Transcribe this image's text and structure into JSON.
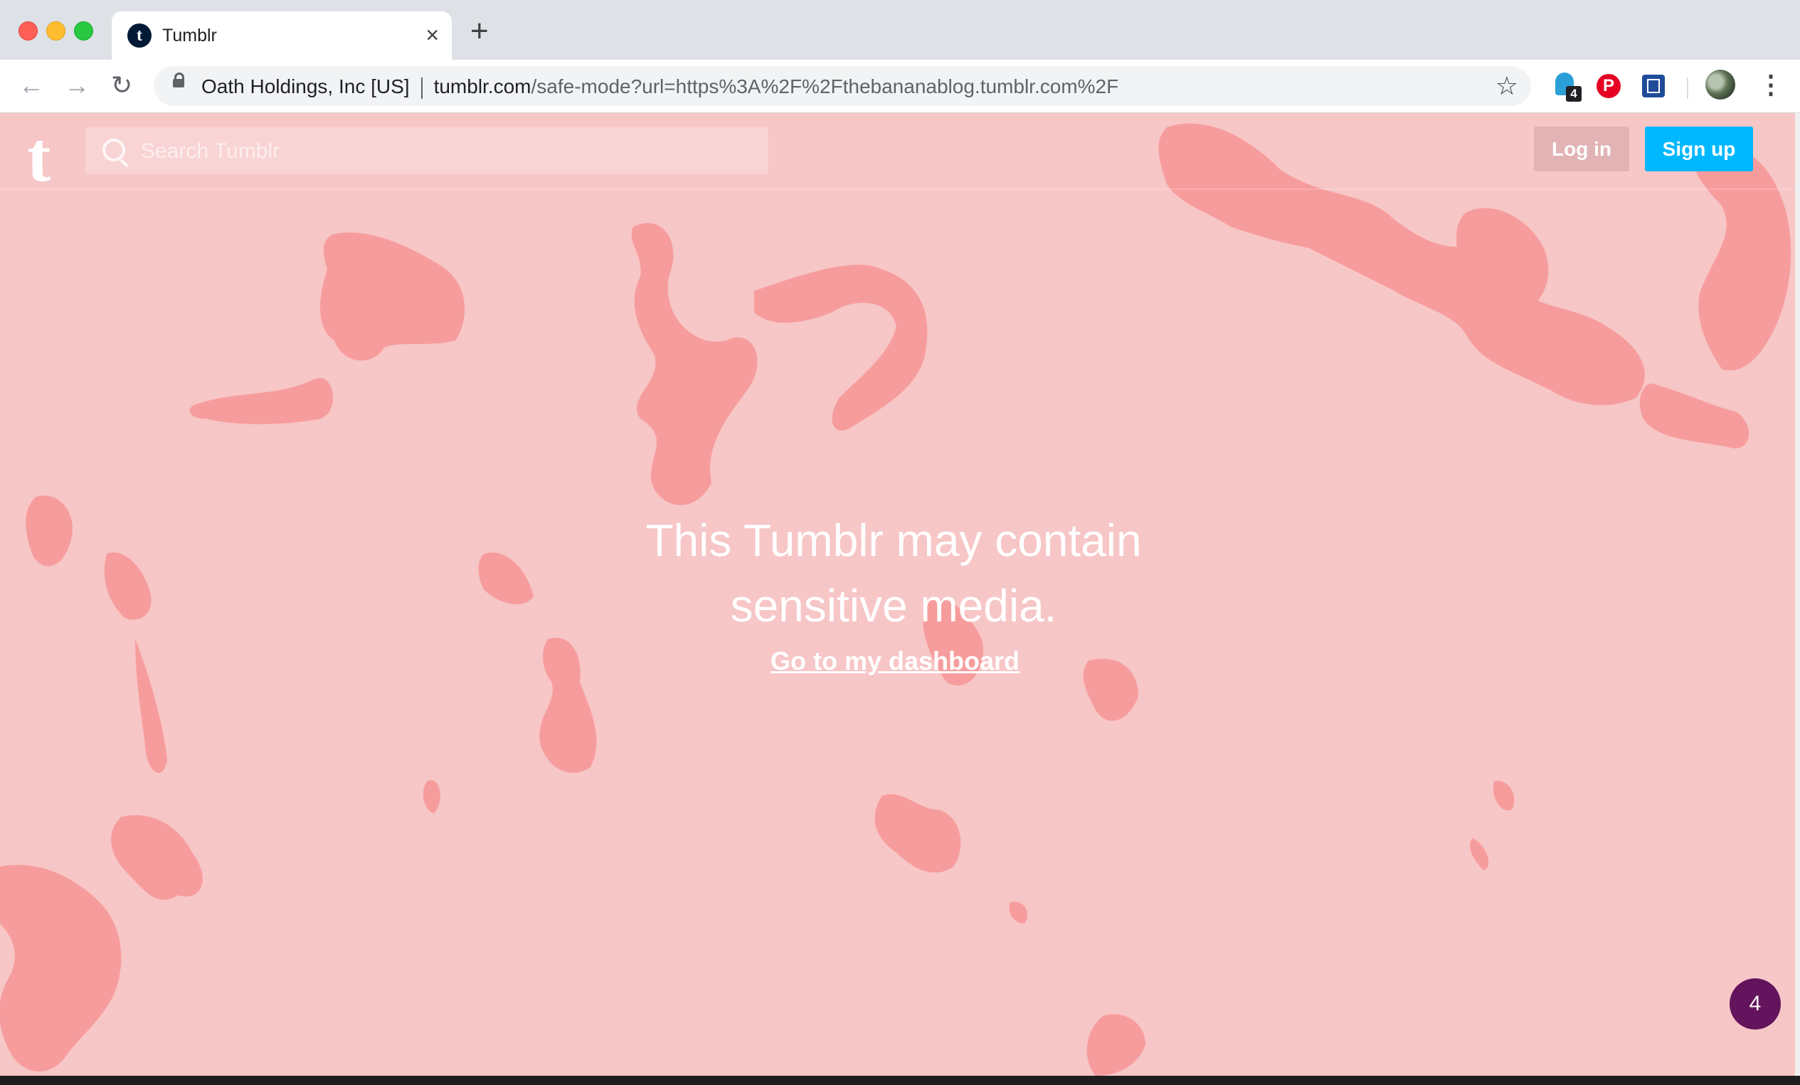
{
  "browser": {
    "tab": {
      "title": "Tumblr",
      "favicon_letter": "t"
    },
    "new_tab_symbol": "+",
    "address": {
      "site_identity": "Oath Holdings, Inc [US]",
      "host": "tumblr.com",
      "path": "/safe-mode?url=https%3A%2F%2Fthebananablog.tumblr.com%2F"
    },
    "extensions": {
      "ghost_badge": "4",
      "pinterest_letter": "P"
    }
  },
  "header": {
    "logo": "t",
    "search_placeholder": "Search Tumblr",
    "login_label": "Log in",
    "signup_label": "Sign up"
  },
  "main": {
    "message_line1": "This Tumblr may contain",
    "message_line2": "sensitive media.",
    "dashboard_link": "Go to my dashboard"
  },
  "notification": {
    "count": "4"
  },
  "colors": {
    "page_background": "#f7c6c7",
    "blob_color": "#f79c9c",
    "signup_button": "#00b8ff",
    "notification_badge": "#63145c"
  },
  "icons": [
    "back-icon",
    "forward-icon",
    "reload-icon",
    "lock-icon",
    "star-icon",
    "search-icon",
    "kebab-menu-icon"
  ]
}
